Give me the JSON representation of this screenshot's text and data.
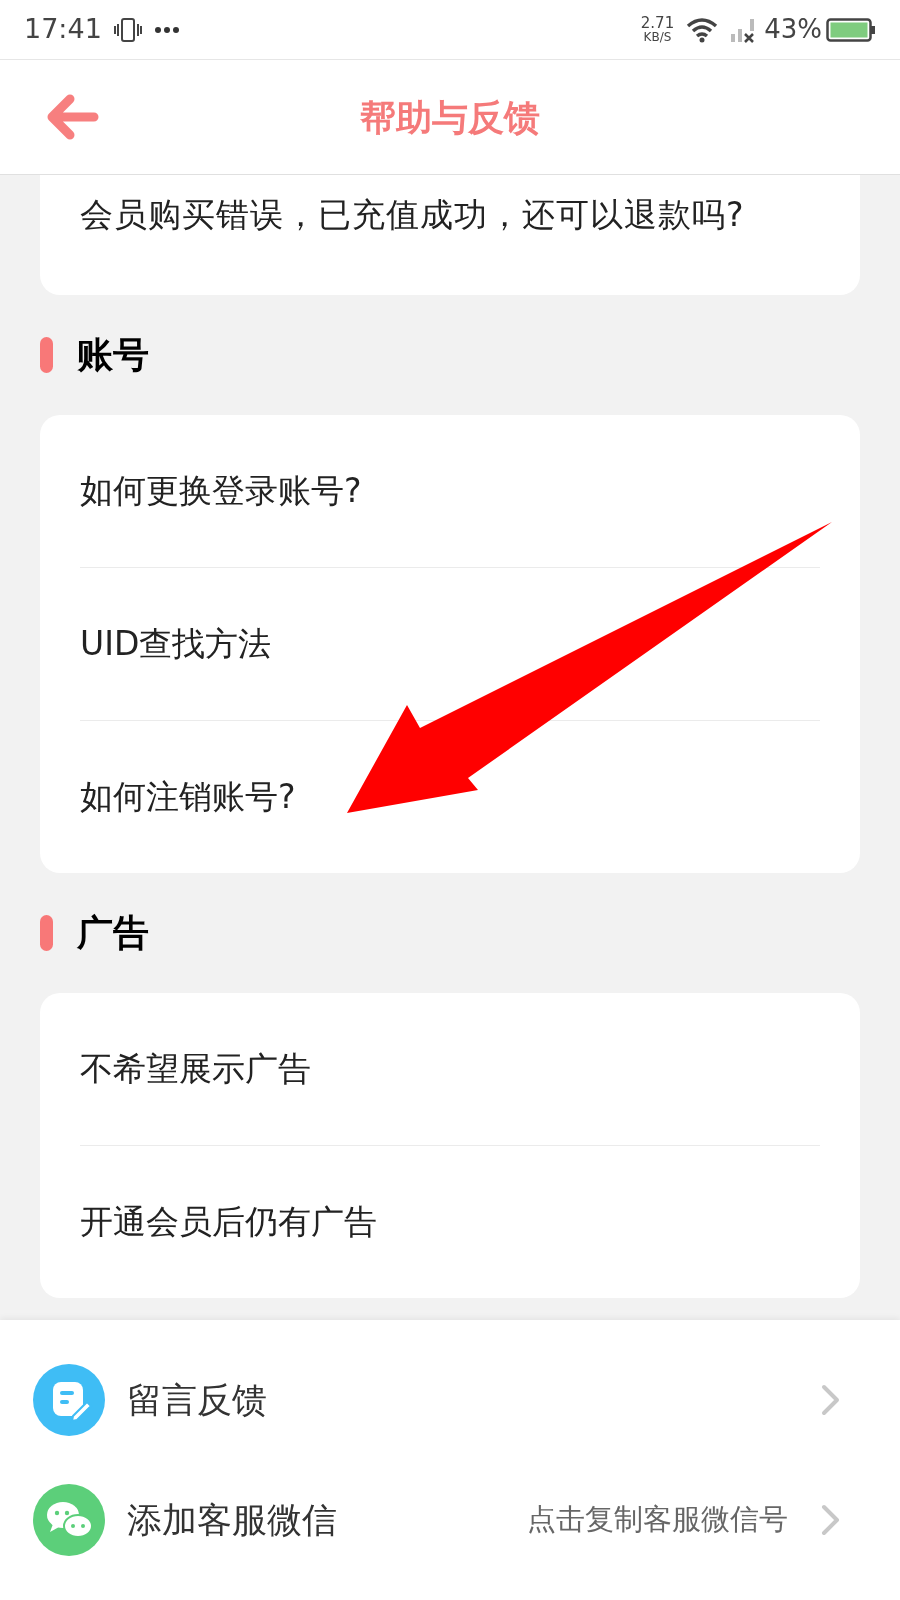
{
  "status_bar": {
    "time": "17:41",
    "net_speed": "2.71",
    "net_unit": "KB/S",
    "battery": "43%"
  },
  "header": {
    "title": "帮助与反馈"
  },
  "sections": [
    {
      "items": [
        "会员购买错误，已充值成功，还可以退款吗?"
      ]
    },
    {
      "title": "账号",
      "items": [
        "如何更换登录账号?",
        "UID查找方法",
        "如何注销账号?"
      ]
    },
    {
      "title": "广告",
      "items": [
        "不希望展示广告",
        "开通会员后仍有广告"
      ]
    }
  ],
  "actions": [
    {
      "kind": "feedback",
      "label": "留言反馈"
    },
    {
      "kind": "wechat",
      "label": "添加客服微信",
      "hint": "点击复制客服微信号"
    }
  ]
}
